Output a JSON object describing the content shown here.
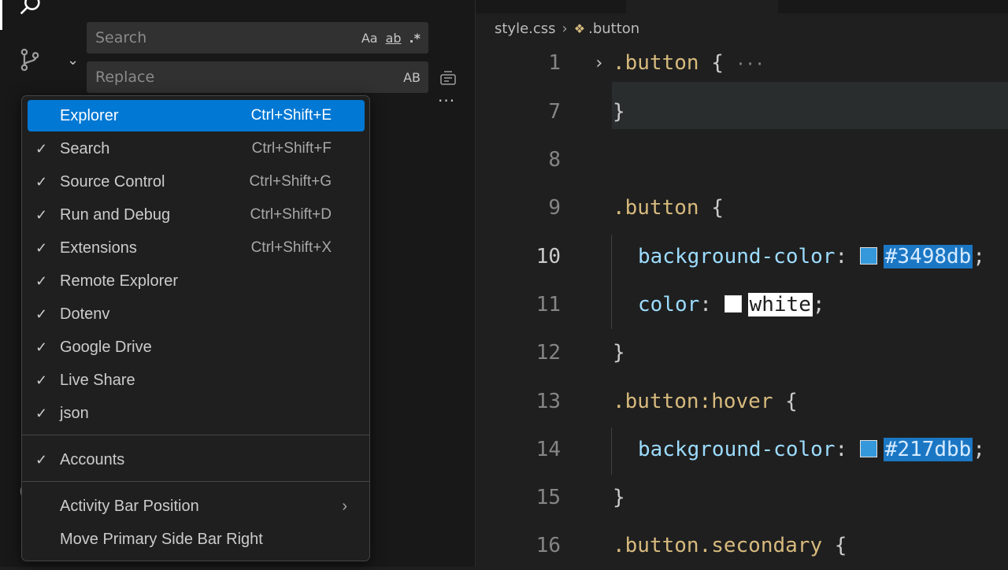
{
  "search": {
    "placeholder": "Search",
    "case_icon_label": "Aa",
    "word_icon_label": "ab",
    "regex_icon_label": ".*"
  },
  "replace": {
    "placeholder": "Replace",
    "preserve_case_label": "AB"
  },
  "breadcrumb": {
    "file": "style.css",
    "symbol": ".button"
  },
  "menu": {
    "items": [
      {
        "label": "Explorer",
        "shortcut": "Ctrl+Shift+E",
        "checked": false,
        "active": true
      },
      {
        "label": "Search",
        "shortcut": "Ctrl+Shift+F",
        "checked": true
      },
      {
        "label": "Source Control",
        "shortcut": "Ctrl+Shift+G",
        "checked": true
      },
      {
        "label": "Run and Debug",
        "shortcut": "Ctrl+Shift+D",
        "checked": true
      },
      {
        "label": "Extensions",
        "shortcut": "Ctrl+Shift+X",
        "checked": true
      },
      {
        "label": "Remote Explorer",
        "shortcut": "",
        "checked": true
      },
      {
        "label": "Dotenv",
        "shortcut": "",
        "checked": true
      },
      {
        "label": "Google Drive",
        "shortcut": "",
        "checked": true
      },
      {
        "label": "Live Share",
        "shortcut": "",
        "checked": true
      },
      {
        "label": "json",
        "shortcut": "",
        "checked": true
      },
      {
        "label": "Accounts",
        "shortcut": "",
        "checked": true
      },
      {
        "label": "Activity Bar Position",
        "shortcut": "",
        "checked": false,
        "submenu": true
      },
      {
        "label": "Move Primary Side Bar Right",
        "shortcut": "",
        "checked": false
      }
    ],
    "check_glyph": "✓"
  },
  "editor": {
    "lines": [
      {
        "n": "1",
        "sel": ".button",
        "open": " {",
        "ellipsis": "···",
        "folded": true
      },
      {
        "n": "7",
        "brace": "}"
      },
      {
        "n": "8"
      },
      {
        "n": "9",
        "sel": ".button",
        "open": " {"
      },
      {
        "n": "10",
        "prop": "background-color",
        "colon": ": ",
        "value": "#3498db",
        "semi": ";",
        "swatch": "#3498db",
        "current": true
      },
      {
        "n": "11",
        "prop": "color",
        "colon": ": ",
        "value": "white",
        "semi": ";",
        "swatch": "#ffffff"
      },
      {
        "n": "12",
        "brace": "}"
      },
      {
        "n": "13",
        "sel": ".button:hover",
        "open": " {"
      },
      {
        "n": "14",
        "prop": "background-color",
        "colon": ": ",
        "value": "#217dbb",
        "semi": ";",
        "swatch": "#3498db"
      },
      {
        "n": "15",
        "brace": "}"
      },
      {
        "n": "16",
        "sel": ".button.secondary",
        "open": " {"
      }
    ]
  },
  "colors": {
    "accent": "#0078d4",
    "highlight_blue": "#1b77c4",
    "selector": "#d7ba7d",
    "property": "#9cdcfe"
  }
}
